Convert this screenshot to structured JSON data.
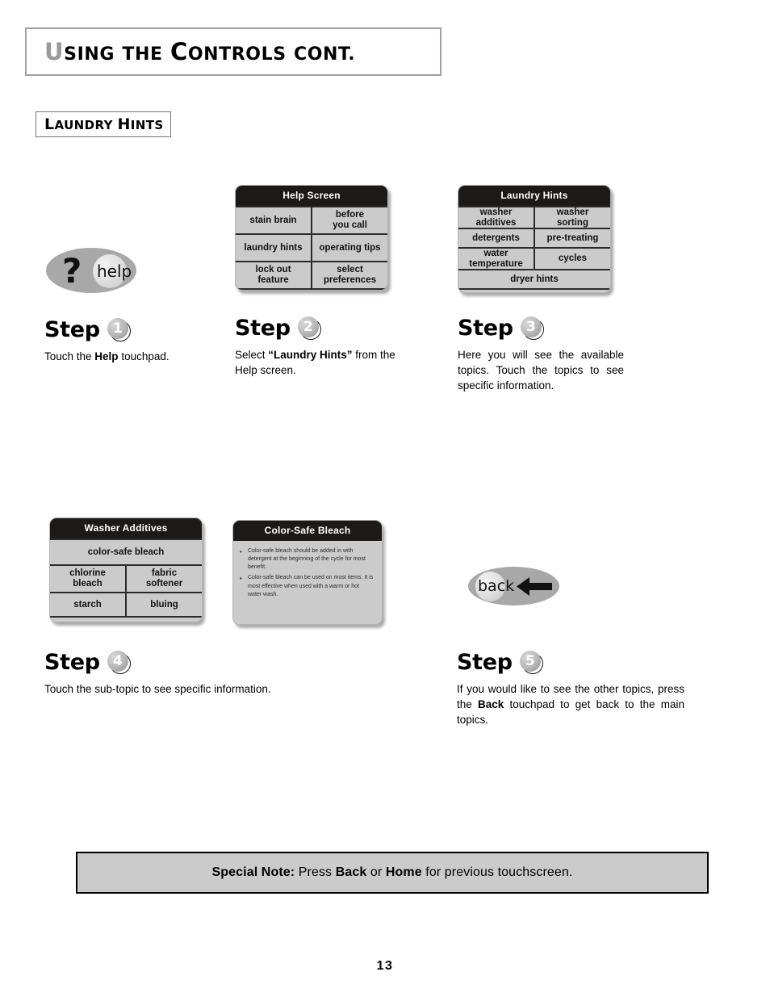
{
  "header": {
    "title_parts": {
      "u": "U",
      "sing": "SING",
      "the": "THE",
      "c": "C",
      "ontrols": "ONTROLS",
      "cont": "CONT."
    },
    "title_full": "Using the Controls cont."
  },
  "section": {
    "label_l": "L",
    "label_aundry": "AUNDRY",
    "label_h": "H",
    "label_ints": "INTS",
    "label_full": "Laundry Hints"
  },
  "panels": {
    "help_screen": {
      "title": "Help Screen",
      "cells": [
        {
          "label": "stain brain",
          "width": "half"
        },
        {
          "label": "before\nyou call",
          "width": "half"
        },
        {
          "label": "laundry hints",
          "width": "half"
        },
        {
          "label": "operating tips",
          "width": "half"
        },
        {
          "label": "lock out\nfeature",
          "width": "half"
        },
        {
          "label": "select\npreferences",
          "width": "half"
        }
      ]
    },
    "laundry_hints": {
      "title": "Laundry Hints",
      "cells": [
        {
          "label": "washer\nadditives",
          "width": "half"
        },
        {
          "label": "washer\nsorting",
          "width": "half"
        },
        {
          "label": "detergents",
          "width": "half"
        },
        {
          "label": "pre-treating",
          "width": "half"
        },
        {
          "label": "water\ntemperature",
          "width": "half"
        },
        {
          "label": "cycles",
          "width": "half"
        },
        {
          "label": "dryer hints",
          "width": "full"
        }
      ]
    },
    "washer_additives": {
      "title": "Washer Additives",
      "cells": [
        {
          "label": "color-safe bleach",
          "width": "full"
        },
        {
          "label": "chlorine\nbleach",
          "width": "half"
        },
        {
          "label": "fabric\nsoftener",
          "width": "half"
        },
        {
          "label": "starch",
          "width": "half"
        },
        {
          "label": "bluing",
          "width": "half"
        }
      ]
    },
    "color_safe_bleach": {
      "title": "Color-Safe Bleach",
      "bullets": [
        "Color-safe bleach should be added in with detergent at the beginning of the cycle for most benefit.",
        "Color-safe bleach can be used on most items. It is most effective when used with a warm or hot water wash."
      ],
      "bullet_char": "•"
    }
  },
  "touchpads": {
    "help": {
      "symbol": "?",
      "label": "help"
    },
    "back": {
      "label": "back",
      "arrow": "left-arrow"
    }
  },
  "steps": [
    {
      "word": "Step",
      "number": "1",
      "body_pre": "Touch the ",
      "body_bold": "Help",
      "body_post": " touchpad.",
      "justify": false
    },
    {
      "word": "Step",
      "number": "2",
      "body_pre": "Select ",
      "body_bold": "“Laundry Hints”",
      "body_post": " from the Help screen.",
      "justify": false
    },
    {
      "word": "Step",
      "number": "3",
      "body_pre": "Here you will see the available topics. Touch the topics to see specific information.",
      "body_bold": "",
      "body_post": "",
      "justify": true
    },
    {
      "word": "Step",
      "number": "4",
      "body_pre": "Touch the sub-topic to see specific information.",
      "body_bold": "",
      "body_post": "",
      "justify": false
    },
    {
      "word": "Step",
      "number": "5",
      "body_pre": "If you would like to see the other topics, press the ",
      "body_bold": "Back",
      "body_post": " touchpad to get back to the main topics.",
      "justify": true
    }
  ],
  "special_note": {
    "label": "Special Note:",
    "text_1": " Press ",
    "bold_1": "Back",
    "text_2": " or ",
    "bold_2": "Home",
    "text_3": " for previous touchscreen."
  },
  "footer": {
    "page_number": "13"
  },
  "colors": {
    "panel_bg": "#cbcbcb",
    "panel_header_bg": "#1c1a18",
    "touchpad_bg": "#a8a8a8",
    "header_u_gray": "#999999",
    "note_bg": "#cbcbcb"
  }
}
